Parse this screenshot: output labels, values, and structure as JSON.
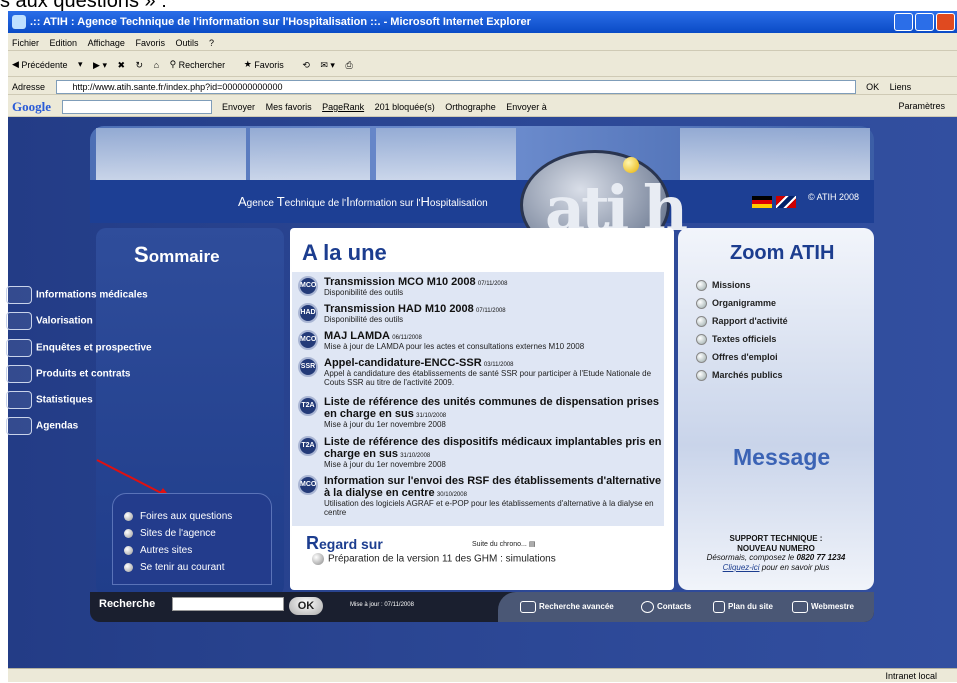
{
  "caption": "s aux questions » :",
  "window": {
    "title": ".:: ATIH : Agence Technique de l'information sur l'Hospitalisation ::. - Microsoft Internet Explorer"
  },
  "menu": [
    "Fichier",
    "Edition",
    "Affichage",
    "Favoris",
    "Outils",
    "?"
  ],
  "toolbar": {
    "back": "Précédente",
    "search": "Rechercher",
    "favorites": "Favoris"
  },
  "address": {
    "label": "Adresse",
    "url": "http://www.atih.sante.fr/index.php?id=000000000000",
    "go": "OK",
    "links": "Liens"
  },
  "google": {
    "logo": "Google",
    "send": "Envoyer",
    "favorites": "Mes favoris",
    "pagerank": "PageRank",
    "blocked": "201 bloquée(s)",
    "spell": "Orthographe",
    "sendto": "Envoyer à",
    "settings": "Paramètres"
  },
  "status": {
    "zone": "Intranet local"
  },
  "banner": {
    "agency_parts": [
      {
        "c": "A",
        "r": "gence "
      },
      {
        "c": "T",
        "r": "echnique de l'"
      },
      {
        "c": "I",
        "r": "nformation sur l'"
      },
      {
        "c": "H",
        "r": "ospitalisation"
      }
    ],
    "copyright": "© ATIH 2008",
    "logo": "ati h"
  },
  "sommaire": {
    "title_cap": "S",
    "title_rest": "ommaire",
    "items": [
      {
        "label": "Informations médicales",
        "icon": "medical-icon"
      },
      {
        "label": "Valorisation",
        "icon": "valuation-icon"
      },
      {
        "label": "Enquêtes et prospective",
        "icon": "magnifier-icon"
      },
      {
        "label": "Produits et contrats",
        "icon": "products-icon"
      },
      {
        "label": "Statistiques",
        "icon": "statistics-icon"
      },
      {
        "label": "Agendas",
        "icon": "agenda-icon"
      }
    ]
  },
  "links": [
    "Foires aux questions",
    "Sites de l'agence",
    "Autres sites",
    "Se tenir au courant"
  ],
  "une": {
    "title": "A la une",
    "news": [
      {
        "badge": "MCO",
        "title": "Transmission MCO M10 2008",
        "date": "07/11/2008",
        "desc": "Disponibilité des outils"
      },
      {
        "badge": "HAD",
        "title": "Transmission HAD M10 2008",
        "date": "07/11/2008",
        "desc": "Disponibilité des outils"
      },
      {
        "badge": "MCO",
        "title": "MAJ LAMDA",
        "date": "06/11/2008",
        "desc": "Mise à jour de LAMDA pour les actes et consultations externes M10 2008"
      },
      {
        "badge": "SSR",
        "title": "Appel-candidature-ENCC-SSR",
        "date": "03/11/2008",
        "desc": "Appel à candidature des établissements de santé SSR pour participer à l'Etude Nationale de Couts SSR au titre de l'activité 2009."
      },
      {
        "badge": "T2A",
        "title": "Liste de référence des unités communes de dispensation prises en charge en sus",
        "date": "31/10/2008",
        "desc": "Mise à jour du 1er novembre 2008"
      },
      {
        "badge": "T2A",
        "title": "Liste de référence des dispositifs médicaux implantables pris en charge en sus",
        "date": "31/10/2008",
        "desc": "Mise à jour du 1er novembre 2008"
      },
      {
        "badge": "MCO",
        "title": "Information sur l'envoi des RSF des établissements d'alternative à la dialyse en centre",
        "date": "30/10/2008",
        "desc": "Utilisation des logiciels AGRAF et e-POP pour les établissements d'alternative à la dialyse en centre"
      }
    ],
    "regard_cap": "R",
    "regard_rest": "egard sur",
    "suite": "Suite du chrono...",
    "prep": "Préparation de la version 11 des GHM : simulations"
  },
  "zoom": {
    "title": "Zoom ATIH",
    "items": [
      "Missions",
      "Organigramme",
      "Rapport d'activité",
      "Textes officiels",
      "Offres d'emploi",
      "Marchés publics"
    ],
    "message": "Message",
    "support_title": "SUPPORT TECHNIQUE :",
    "support_sub": "NOUVEAU NUMERO",
    "support_line_pre": "Désormais, composez le ",
    "support_phone": "0820 77 1234",
    "support_link": "Cliquez-ici",
    "support_link_post": " pour en savoir plus"
  },
  "footer": {
    "search_label": "Recherche",
    "ok": "OK",
    "maj": "Mise à jour : 07/11/2008",
    "links": [
      "Recherche avancée",
      "Contacts",
      "Plan du site",
      "Webmestre"
    ]
  }
}
